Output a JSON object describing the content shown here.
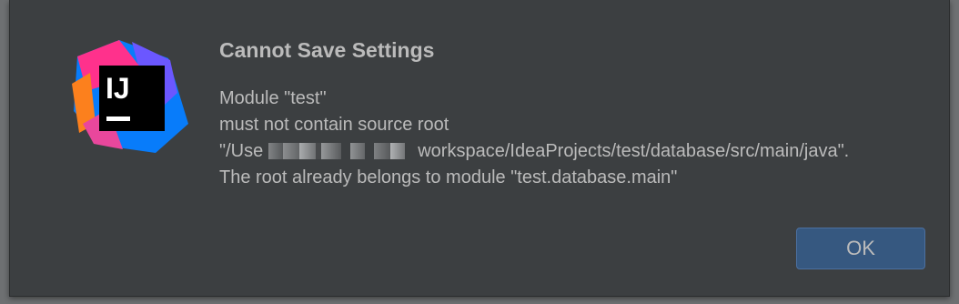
{
  "dialog": {
    "title": "Cannot Save Settings",
    "message_lines": [
      "Module \"test\"",
      "must not contain source root",
      "workspace/IdeaProjects/test/database/src/main/java\".",
      "The root already belongs to module \"test.database.main\""
    ],
    "path_prefix": "\"/Use",
    "logo_text": "IJ",
    "ok_label": "OK"
  },
  "colors": {
    "dialog_background": "#3c3f41",
    "text": "#bbbbbb",
    "ok_button": "#365880",
    "logo_pink": "#ff318c",
    "logo_orange": "#fc801d",
    "logo_blue": "#087cfa",
    "logo_purple": "#6b57ff"
  },
  "icons": {
    "logo": "intellij-idea-logo-icon"
  }
}
